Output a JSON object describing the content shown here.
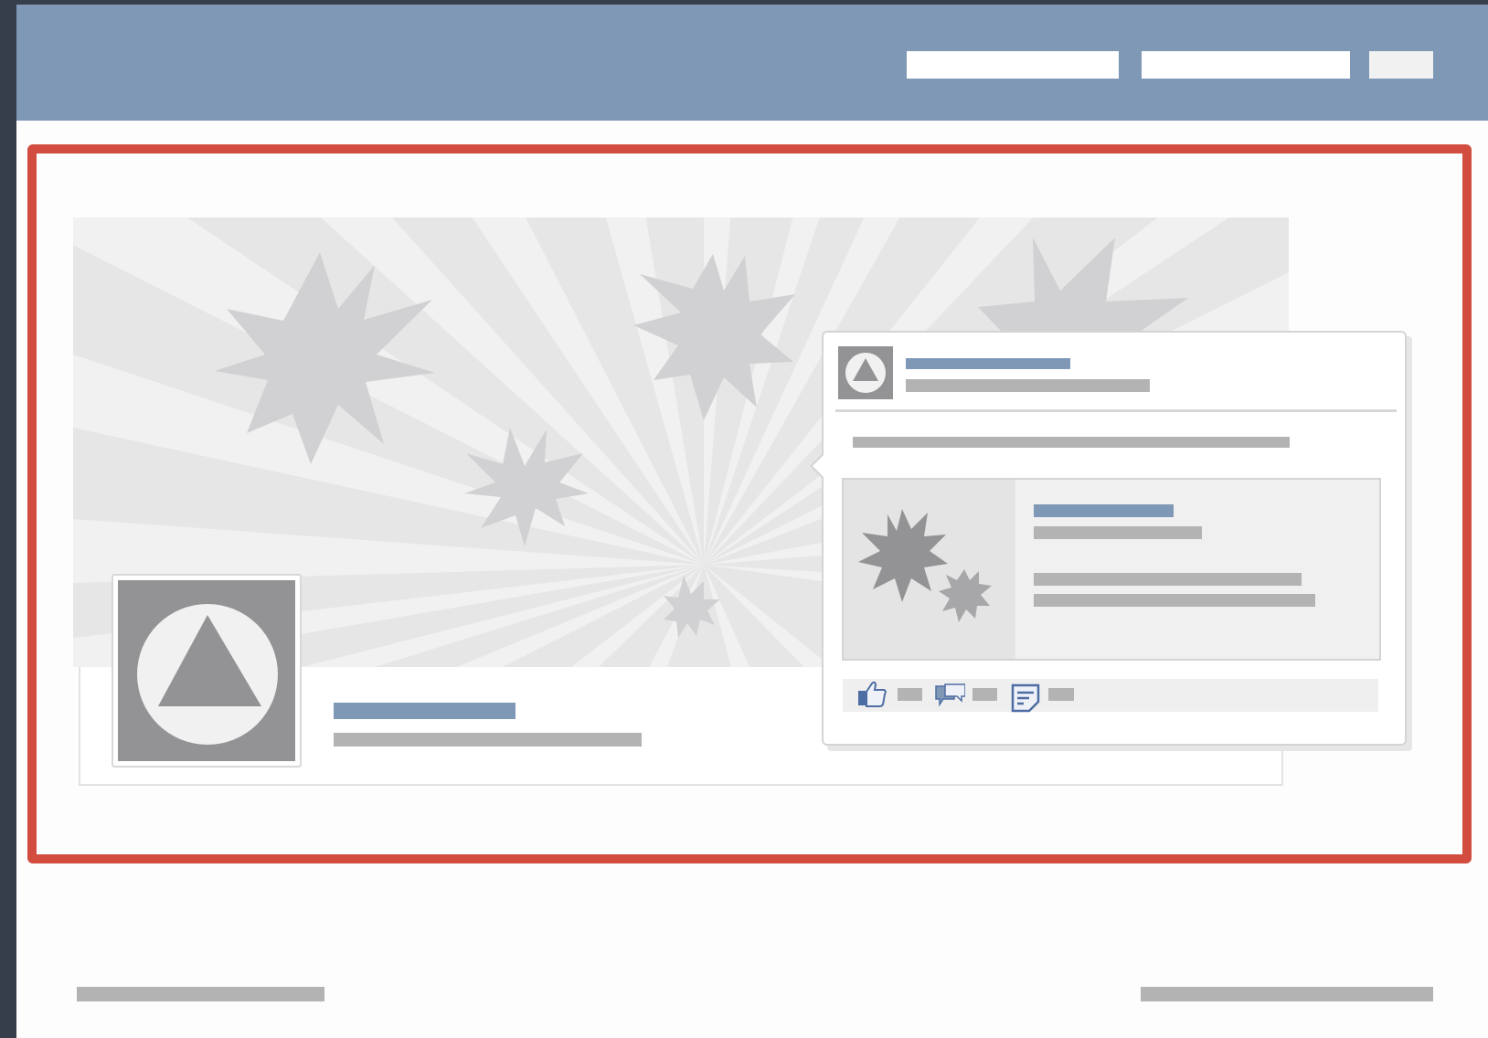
{
  "colors": {
    "header_background": "#7e98b6",
    "window_edge": "#363e4c",
    "highlight_border": "#d24d3f",
    "placeholder_blue": "#7e98b6",
    "placeholder_grey": "#b3b3b3",
    "avatar_grey": "#939396",
    "cover_stars": "#d1d1d3"
  },
  "header": {
    "search_field_1": {
      "value": "",
      "placeholder": ""
    },
    "search_field_2": {
      "value": "",
      "placeholder": ""
    },
    "submit_button": {
      "label": ""
    }
  },
  "page": {
    "cover_photo": {
      "icon": "starburst-pattern"
    },
    "profile_picture": {
      "icon": "triangle-in-circle-logo"
    }
  },
  "popup": {
    "avatar": {
      "icon": "triangle-in-circle-logo"
    },
    "attachment": {
      "thumbnail_icon": "starburst-icon"
    },
    "actions": [
      {
        "name": "like",
        "icon": "thumbs-up-icon"
      },
      {
        "name": "comment",
        "icon": "speech-bubbles-icon"
      },
      {
        "name": "share",
        "icon": "document-note-icon"
      }
    ]
  }
}
